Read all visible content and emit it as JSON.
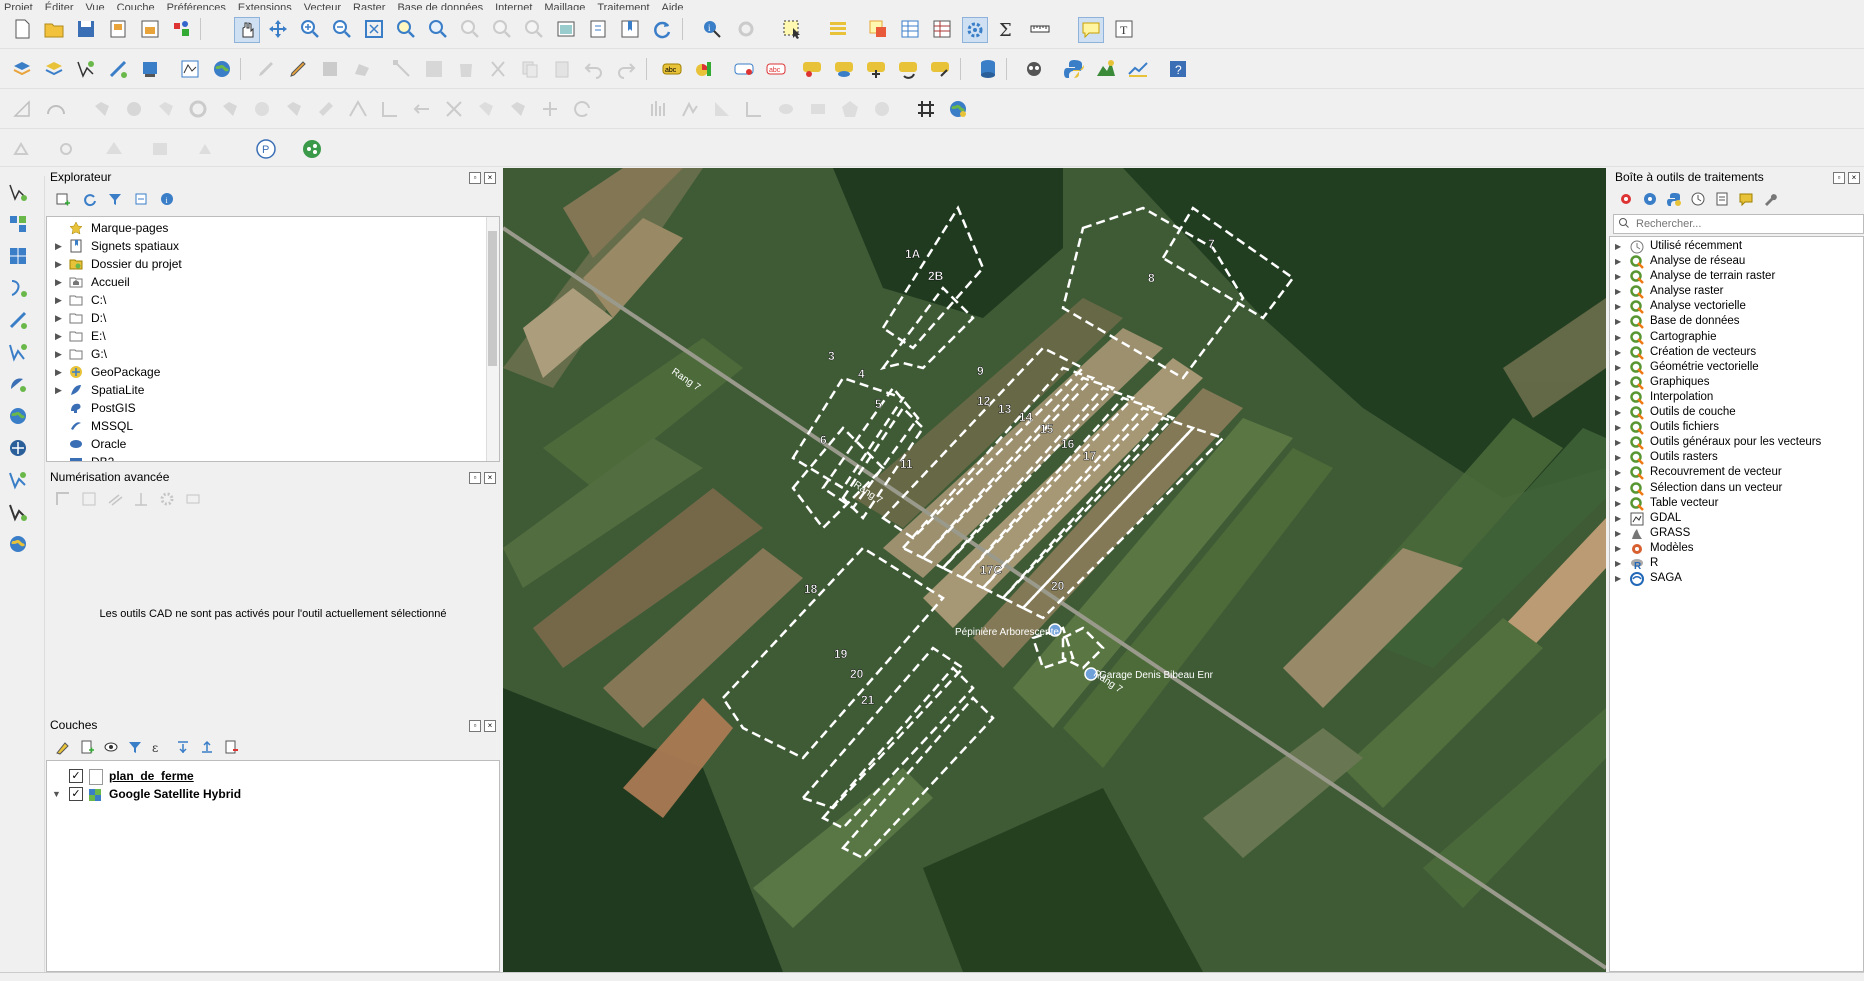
{
  "menu": [
    "Projet",
    "Éditer",
    "Vue",
    "Couche",
    "Préférences",
    "Extensions",
    "Vecteur",
    "Raster",
    "Base de données",
    "Internet",
    "Maillage",
    "Traitement",
    "Aide"
  ],
  "explorer": {
    "title": "Explorateur",
    "items": [
      {
        "label": "Marque-pages",
        "icon": "star-icon",
        "expand": false
      },
      {
        "label": "Signets spatiaux",
        "icon": "spatial-bookmark-icon",
        "expand": true
      },
      {
        "label": "Dossier du projet",
        "icon": "project-folder-icon",
        "expand": true
      },
      {
        "label": "Accueil",
        "icon": "home-folder-icon",
        "expand": true
      },
      {
        "label": "C:\\",
        "icon": "drive-icon",
        "expand": true
      },
      {
        "label": "D:\\",
        "icon": "drive-icon",
        "expand": true
      },
      {
        "label": "E:\\",
        "icon": "drive-icon",
        "expand": true
      },
      {
        "label": "G:\\",
        "icon": "drive-icon",
        "expand": true
      },
      {
        "label": "GeoPackage",
        "icon": "geopackage-icon",
        "expand": true
      },
      {
        "label": "SpatiaLite",
        "icon": "spatialite-icon",
        "expand": true
      },
      {
        "label": "PostGIS",
        "icon": "postgis-icon",
        "expand": false
      },
      {
        "label": "MSSQL",
        "icon": "mssql-icon",
        "expand": false
      },
      {
        "label": "Oracle",
        "icon": "oracle-icon",
        "expand": false
      },
      {
        "label": "DB2",
        "icon": "db2-icon",
        "expand": false
      }
    ]
  },
  "digitizing": {
    "title": "Numérisation avancée",
    "message": "Les outils CAD ne sont pas activés pour l'outil actuellement sélectionné"
  },
  "layers": {
    "title": "Couches",
    "items": [
      {
        "label": "plan_de_ferme",
        "checked": true
      },
      {
        "label": "Google Satellite Hybrid",
        "checked": true
      }
    ]
  },
  "toolbox": {
    "title": "Boîte à outils de traitements",
    "search_placeholder": "Rechercher...",
    "items": [
      {
        "label": "Utilisé récemment",
        "icon": "clock-icon"
      },
      {
        "label": "Analyse de réseau",
        "icon": "qgis-icon"
      },
      {
        "label": "Analyse de terrain raster",
        "icon": "qgis-icon"
      },
      {
        "label": "Analyse raster",
        "icon": "qgis-icon"
      },
      {
        "label": "Analyse vectorielle",
        "icon": "qgis-icon"
      },
      {
        "label": "Base de données",
        "icon": "qgis-icon"
      },
      {
        "label": "Cartographie",
        "icon": "qgis-icon"
      },
      {
        "label": "Création de vecteurs",
        "icon": "qgis-icon"
      },
      {
        "label": "Géométrie vectorielle",
        "icon": "qgis-icon"
      },
      {
        "label": "Graphiques",
        "icon": "qgis-icon"
      },
      {
        "label": "Interpolation",
        "icon": "qgis-icon"
      },
      {
        "label": "Outils de couche",
        "icon": "qgis-icon"
      },
      {
        "label": "Outils fichiers",
        "icon": "qgis-icon"
      },
      {
        "label": "Outils généraux pour les vecteurs",
        "icon": "qgis-icon"
      },
      {
        "label": "Outils rasters",
        "icon": "qgis-icon"
      },
      {
        "label": "Recouvrement de vecteur",
        "icon": "qgis-icon"
      },
      {
        "label": "Sélection dans un vecteur",
        "icon": "qgis-icon"
      },
      {
        "label": "Table vecteur",
        "icon": "qgis-icon"
      },
      {
        "label": "GDAL",
        "icon": "gdal-icon"
      },
      {
        "label": "GRASS",
        "icon": "grass-icon"
      },
      {
        "label": "Modèles",
        "icon": "models-icon"
      },
      {
        "label": "R",
        "icon": "r-icon"
      },
      {
        "label": "SAGA",
        "icon": "saga-icon"
      }
    ]
  },
  "map": {
    "parcel_labels": [
      "1A",
      "2B",
      "3",
      "4",
      "5",
      "6",
      "7",
      "8",
      "9",
      "11",
      "12",
      "13",
      "14",
      "15",
      "16",
      "17",
      "17C",
      "18",
      "19",
      "20",
      "20",
      "21"
    ],
    "road_labels": [
      "Rang 7",
      "Rang 7",
      "Rang 7"
    ],
    "pois": [
      "Pépinière Arborescente",
      "Garage Denis Bibeau Enr"
    ]
  }
}
